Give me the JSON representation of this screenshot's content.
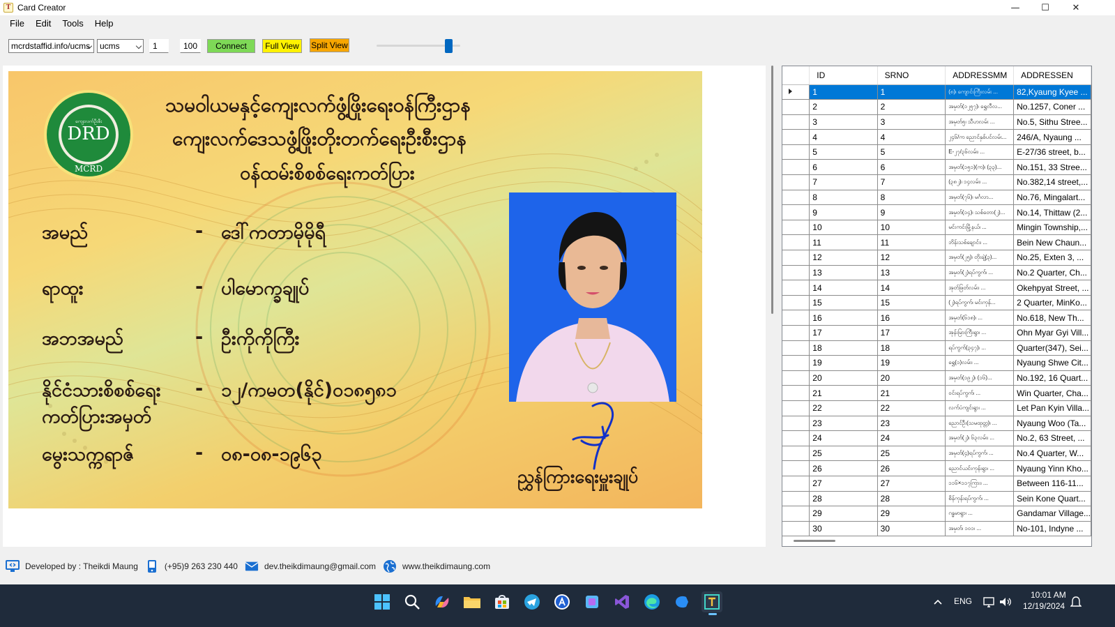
{
  "window": {
    "title": "Card Creator",
    "app_icon_glyph": "T",
    "controls": {
      "minimize": "—",
      "maximize": "☐",
      "close": "✕"
    }
  },
  "menu": [
    "File",
    "Edit",
    "Tools",
    "Help"
  ],
  "toolbar": {
    "server_combo": "mcrdstaffid.info/ucms",
    "db_combo": "ucms",
    "from_value": "1",
    "count_value": "100",
    "connect_label": "Connect",
    "full_view_label": "Full View",
    "split_view_label": "Split View",
    "zoom_level": 0.85
  },
  "card": {
    "heading1": "သမဝါယမနှင့်ကျေးလက်ဖွံ့ဖြိုးရေးဝန်ကြီးဌာန",
    "heading2": "ကျေးလက်ဒေသဖွံ့ဖြိုးတိုးတက်ရေးဦးစီးဌာန",
    "heading3": "ဝန်ထမ်းစိစစ်ရေးကတ်ပြား",
    "seal": {
      "center": "DRD",
      "bottom": "MCRD",
      "top": "ကျေးလက်ဦးစီး"
    },
    "fields": [
      {
        "label": "အမည်",
        "dash": "-",
        "value": "ဒေါ်ကတာမိုမိုရီ"
      },
      {
        "label": "ရာထူး",
        "dash": "-",
        "value": "ပါမောက္ခချုပ်"
      },
      {
        "label": "အဘအမည်",
        "dash": "-",
        "value": "ဦးကိုကိုကြီး"
      },
      {
        "label": "နိုင်ငံသားစိစစ်ရေး",
        "dash": "-",
        "value": "၁၂/ကမတ(နိုင်)၀၁၈၅၈၁"
      },
      {
        "label": "ကတ်ပြားအမှတ်",
        "dash": "",
        "value": ""
      },
      {
        "label": "မွေးသက္ကရာဇ်",
        "dash": "-",
        "value": "၀၈-၀၈-၁၉၆၃"
      }
    ],
    "signer_title": "ညွှန်ကြားရေးမှူးချုပ်",
    "accent_color": "#1e64ea"
  },
  "grid": {
    "columns": [
      "ID",
      "SRNO",
      "ADDRESSMM",
      "ADDRESSEN"
    ],
    "selected_row": 0,
    "rows": [
      [
        "1",
        "1",
        "(၈)၊ ကျောင်းကြီးလမ်း ...",
        "82,Kyaung Kyee ..."
      ],
      [
        "2",
        "2",
        "အမှတ်(၁၂၅၇)၊ ရွှေလီလ...",
        "No.1257, Coner ..."
      ],
      [
        "3",
        "3",
        "အမှတ်၅၊ သီဟလမ်း ...",
        "No.5, Sithu Stree..."
      ],
      [
        "4",
        "4",
        "၂၄၆/က ညောင်နှစ်ပင်လမ်း...",
        "246/A, Nyaung ..."
      ],
      [
        "5",
        "5",
        "E-၂၇/၃၆လမ်း၊ ...",
        "E-27/36 street, b..."
      ],
      [
        "6",
        "6",
        "အမှတ်(၁၅၁)(က)၊ (၃၃)...",
        "No.151, 33 Stree..."
      ],
      [
        "7",
        "7",
        "(၃၈၂)၊ ၁၄လမ်း၊ ...",
        "No.382,14 street,..."
      ],
      [
        "8",
        "8",
        "အမှတ်(၇၆)၊ မင်္ဂလာ...",
        "No.76, Mingalart..."
      ],
      [
        "9",
        "9",
        "အမှတ်(၁၄)၊ သစ်တော(၂)...",
        "No.14, Thittaw (2..."
      ],
      [
        "10",
        "10",
        "မင်းကင်းမြို့နယ်၊ ...",
        "Mingin Township,..."
      ],
      [
        "11",
        "11",
        "ဘိန်းသစ်ချောင်း၊ ...",
        "Bein New Chaun..."
      ],
      [
        "12",
        "12",
        "အမှတ်(၂၅)၊ တိုးချဲ့(၃)...",
        "No.25, Exten 3, ..."
      ],
      [
        "13",
        "13",
        "အမှတ်(၂)ရပ်ကွက်၊ ...",
        "No.2 Quarter, Ch..."
      ],
      [
        "14",
        "14",
        "အုတ်ဖြတ်လမ်း၊ ...",
        "Okehpyat Street, ..."
      ],
      [
        "15",
        "15",
        "(၂)ရပ်ကွက်၊ မင်းကုန်...",
        "2 Quarter, MinKo..."
      ],
      [
        "16",
        "16",
        "အမှတ်(၆၁၈)၊ ...",
        "No.618, New Th..."
      ],
      [
        "17",
        "17",
        "အုန်းမြားကြီးရွာ၊ ...",
        "Ohn Myar Gyi Vill..."
      ],
      [
        "18",
        "18",
        "ရပ်ကွက်(၃၄၇)၊ ...",
        "Quarter(347), Sei..."
      ],
      [
        "19",
        "19",
        "ရွှေ(၁)လမ်း၊ ...",
        "Nyaung Shwe Cit..."
      ],
      [
        "20",
        "20",
        "အမှတ်(၁၉၂)၊ (၁၆)...",
        "No.192, 16 Quart..."
      ],
      [
        "21",
        "21",
        "ဝင်းရပ်ကွက်၊ ...",
        "Win Quarter, Cha..."
      ],
      [
        "22",
        "22",
        "လက်ပံကျင်းရွာ၊ ...",
        "Let Pan Kyin Villa..."
      ],
      [
        "23",
        "23",
        "ညောင်ဦး(သမထုတ္တ)၊ ...",
        "Nyaung Woo (Ta..."
      ],
      [
        "24",
        "24",
        "အမှတ်(၂)၊ ၆၃လမ်း၊ ...",
        "No.2, 63 Street, ..."
      ],
      [
        "25",
        "25",
        "အမှတ်(၄)ရပ်ကွက်၊ ...",
        "No.4 Quarter, W..."
      ],
      [
        "26",
        "26",
        "ညောင်ယင်းကုန်းရွာ၊ ...",
        "Nyaung Yinn Kho..."
      ],
      [
        "27",
        "27",
        "၁၁၆×၁၁၇ကြား၊ ...",
        "Between 116-11..."
      ],
      [
        "28",
        "28",
        "စိန်ကုန်းရပ်ကွက်၊ ...",
        "Sein Kone Quart..."
      ],
      [
        "29",
        "29",
        "ဂန္ဓမာရွာ၊ ...",
        "Gandamar Village..."
      ],
      [
        "30",
        "30",
        "အမှတ်၊ ၁၀၁၊ ...",
        "No-101, Indyne ..."
      ]
    ]
  },
  "footer": {
    "developer": "Developed by : Theikdi Maung",
    "phone": "(+95)9 263 230 440",
    "email": "dev.theikdimaung@gmail.com",
    "website": "www.theikdimaung.com"
  },
  "taskbar": {
    "language": "ENG",
    "time": "10:01 AM",
    "date": "12/19/2024"
  }
}
